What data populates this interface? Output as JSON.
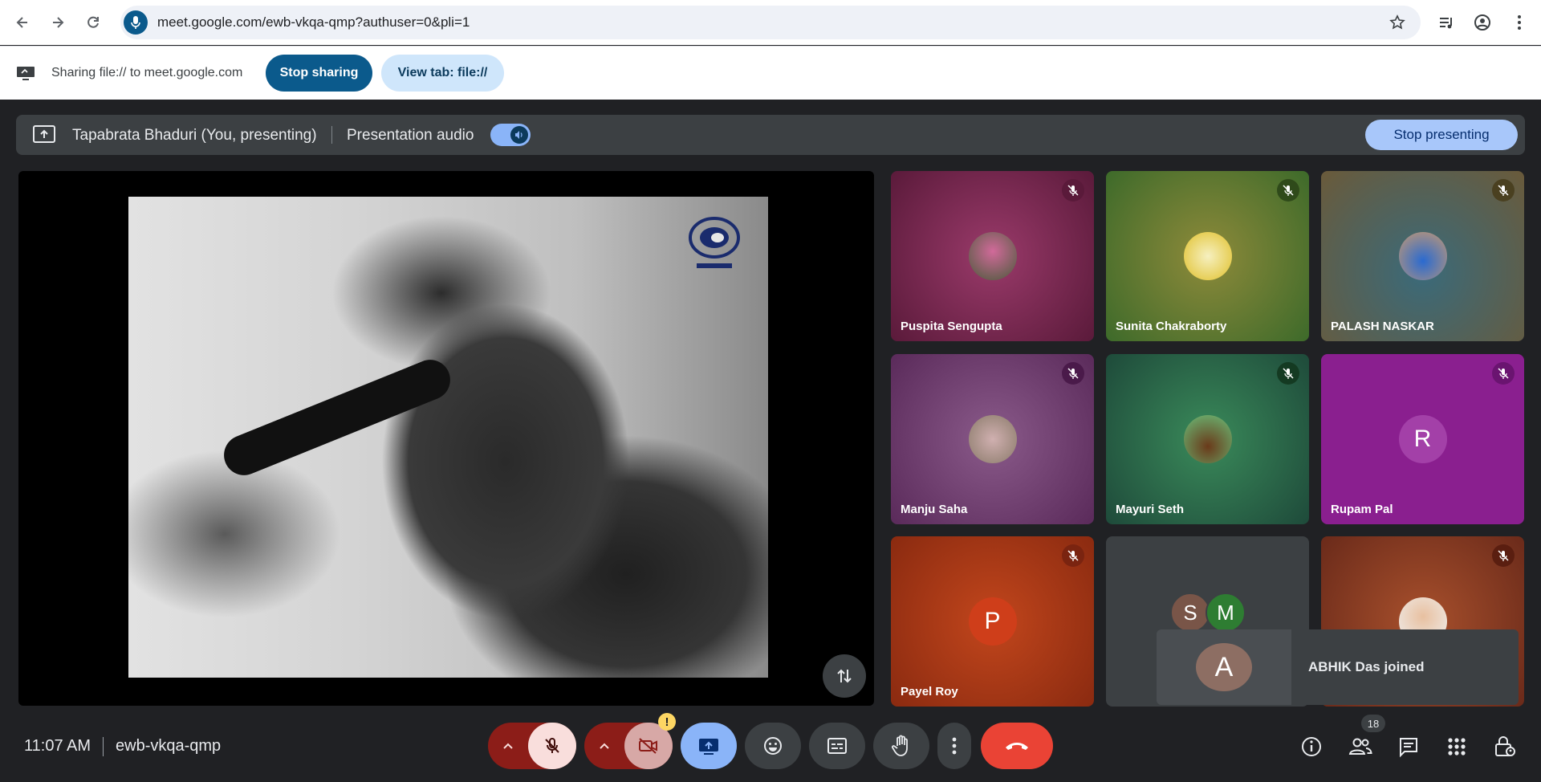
{
  "browser": {
    "url": "meet.google.com/ewb-vkqa-qmp?authuser=0&pli=1",
    "icons": [
      "back-icon",
      "forward-icon",
      "reload-icon",
      "mic-icon",
      "star-icon",
      "media-icon",
      "profile-icon",
      "more-vert-icon"
    ]
  },
  "share_bar": {
    "text": "Sharing file:// to meet.google.com",
    "stop_sharing_label": "Stop sharing",
    "view_tab_label": "View tab: file://"
  },
  "present_bar": {
    "presenter": "Tapabrata Bhaduri (You, presenting)",
    "audio_label": "Presentation audio",
    "audio_on": true,
    "stop_presenting_label": "Stop presenting"
  },
  "participants": [
    {
      "name": "Puspita Sengupta",
      "avatar": "photo",
      "muted": true,
      "bg": "#7a2450"
    },
    {
      "name": "Sunita Chakraborty",
      "avatar": "photo",
      "muted": true,
      "bg": "#6f7a2a"
    },
    {
      "name": "PALASH NASKAR",
      "avatar": "photo",
      "muted": true,
      "bg": "#5e5a3c"
    },
    {
      "name": "Manju Saha",
      "avatar": "photo",
      "muted": true,
      "bg": "#6f3d6b"
    },
    {
      "name": "Mayuri Seth",
      "avatar": "photo",
      "muted": true,
      "bg": "#2f6e4a"
    },
    {
      "name": "Rupam Pal",
      "avatar_letter": "R",
      "muted": true,
      "bg": "#8a1f8f"
    },
    {
      "name": "Payel Roy",
      "avatar_letter": "P",
      "muted": true,
      "bg": "#b53a14"
    },
    {
      "name": "",
      "group_letters": [
        "S",
        "M"
      ],
      "bg": "#3c4043"
    },
    {
      "name": "",
      "avatar": "photo",
      "muted": true,
      "bg": "#8a3d24"
    }
  ],
  "toast": {
    "letter": "A",
    "text": "ABHIK Das joined"
  },
  "bottom": {
    "time": "11:07 AM",
    "meeting_code": "ewb-vkqa-qmp",
    "people_count": "18",
    "camera_warning": "!"
  },
  "colors": {
    "meet_bg": "#202124",
    "end_call": "#ea4335",
    "share_active": "#8ab4f8",
    "stop_sharing": "#0b5a8c"
  }
}
